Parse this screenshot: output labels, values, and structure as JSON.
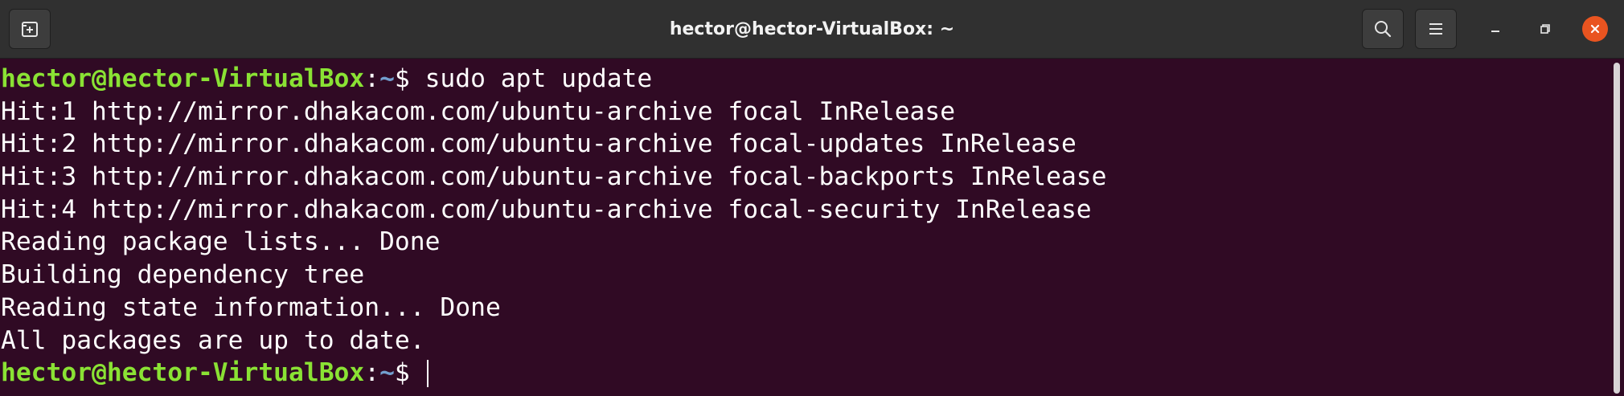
{
  "window": {
    "title": "hector@hector-VirtualBox: ~"
  },
  "header": {
    "new_tab_icon": "new-tab-icon",
    "search_icon": "search-icon",
    "menu_icon": "hamburger-menu-icon",
    "minimize_icon": "minimize-icon",
    "maximize_icon": "restore-icon",
    "close_icon": "close-icon",
    "close_color": "#e95420"
  },
  "prompt": {
    "user_host": "hector@hector-VirtualBox",
    "colon": ":",
    "path": "~",
    "dollar": "$ "
  },
  "terminal": {
    "command": "sudo apt update",
    "output": [
      "Hit:1 http://mirror.dhakacom.com/ubuntu-archive focal InRelease",
      "Hit:2 http://mirror.dhakacom.com/ubuntu-archive focal-updates InRelease",
      "Hit:3 http://mirror.dhakacom.com/ubuntu-archive focal-backports InRelease",
      "Hit:4 http://mirror.dhakacom.com/ubuntu-archive focal-security InRelease",
      "Reading package lists... Done",
      "Building dependency tree",
      "Reading state information... Done",
      "All packages are up to date."
    ],
    "colors": {
      "background": "#300a24",
      "user_host": "#8ae234",
      "path": "#729fcf",
      "text": "#ffffff"
    }
  }
}
